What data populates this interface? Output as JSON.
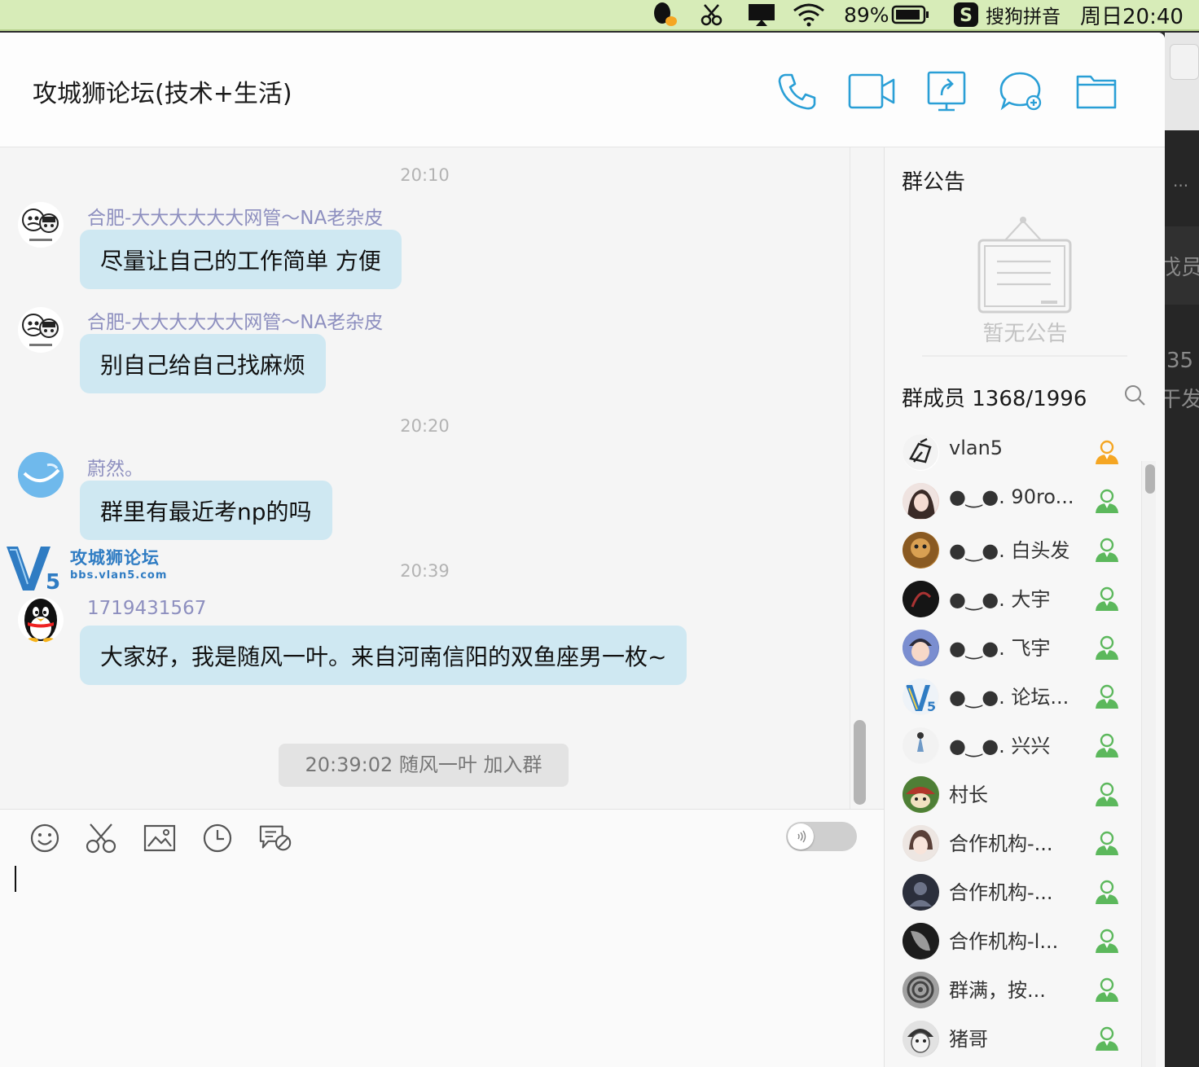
{
  "menubar": {
    "battery": "89%",
    "ime_label": "搜狗拼音",
    "clock": "周日20:40"
  },
  "window": {
    "title": "攻城狮论坛(技术+生活)",
    "toolbar_icons": [
      "phone-icon",
      "video-icon",
      "screen-share-icon",
      "chat-plus-icon",
      "folder-icon"
    ]
  },
  "watermark": {
    "logo_text": "V5",
    "name": "攻城狮论坛",
    "url": "bbs.vlan5.com"
  },
  "chat": {
    "ts1": "20:10",
    "msg1": {
      "sender": "合肥-大大大大大大网管～NA老杂皮",
      "text": "尽量让自己的工作简单 方便"
    },
    "msg2": {
      "sender": "合肥-大大大大大大网管～NA老杂皮",
      "text": "别自己给自己找麻烦"
    },
    "ts2": "20:20",
    "msg3": {
      "sender": "蔚然。",
      "text": "群里有最近考np的吗"
    },
    "ts3": "20:39",
    "msg4": {
      "sender": "1719431567",
      "text": "大家好，我是随风一叶。来自河南信阳的双鱼座男一枚~"
    },
    "system": "20:39:02 随风一叶 加入群"
  },
  "side": {
    "notice_title": "群公告",
    "no_notice": "暂无公告",
    "members_title": "群成员 1368/1996",
    "members": [
      {
        "name": "vlan5",
        "role": "owner"
      },
      {
        "name": "●‿●. 90ro...",
        "role": "member"
      },
      {
        "name": "●‿●. 白头发",
        "role": "member"
      },
      {
        "name": "●‿●. 大宇",
        "role": "member"
      },
      {
        "name": "●‿●. 飞宇",
        "role": "member"
      },
      {
        "name": "●‿●. 论坛...",
        "role": "member"
      },
      {
        "name": "●‿●. 兴兴",
        "role": "member"
      },
      {
        "name": "村长",
        "role": "member"
      },
      {
        "name": "合作机构-...",
        "role": "member"
      },
      {
        "name": "合作机构-...",
        "role": "member"
      },
      {
        "name": "合作机构-l...",
        "role": "member"
      },
      {
        "name": "群满，按...",
        "role": "member"
      },
      {
        "name": "猪哥",
        "role": "member"
      }
    ]
  },
  "behind_window": {
    "frag1": "...",
    "frag2": "戊员",
    "frag3": "35",
    "frag4": "干发"
  },
  "colors": {
    "accent_blue": "#2a9fd6",
    "bubble": "#cfe8f2",
    "sender": "#8d8fbf",
    "owner_icon": "#f5a623",
    "member_icon": "#5cb85c"
  }
}
